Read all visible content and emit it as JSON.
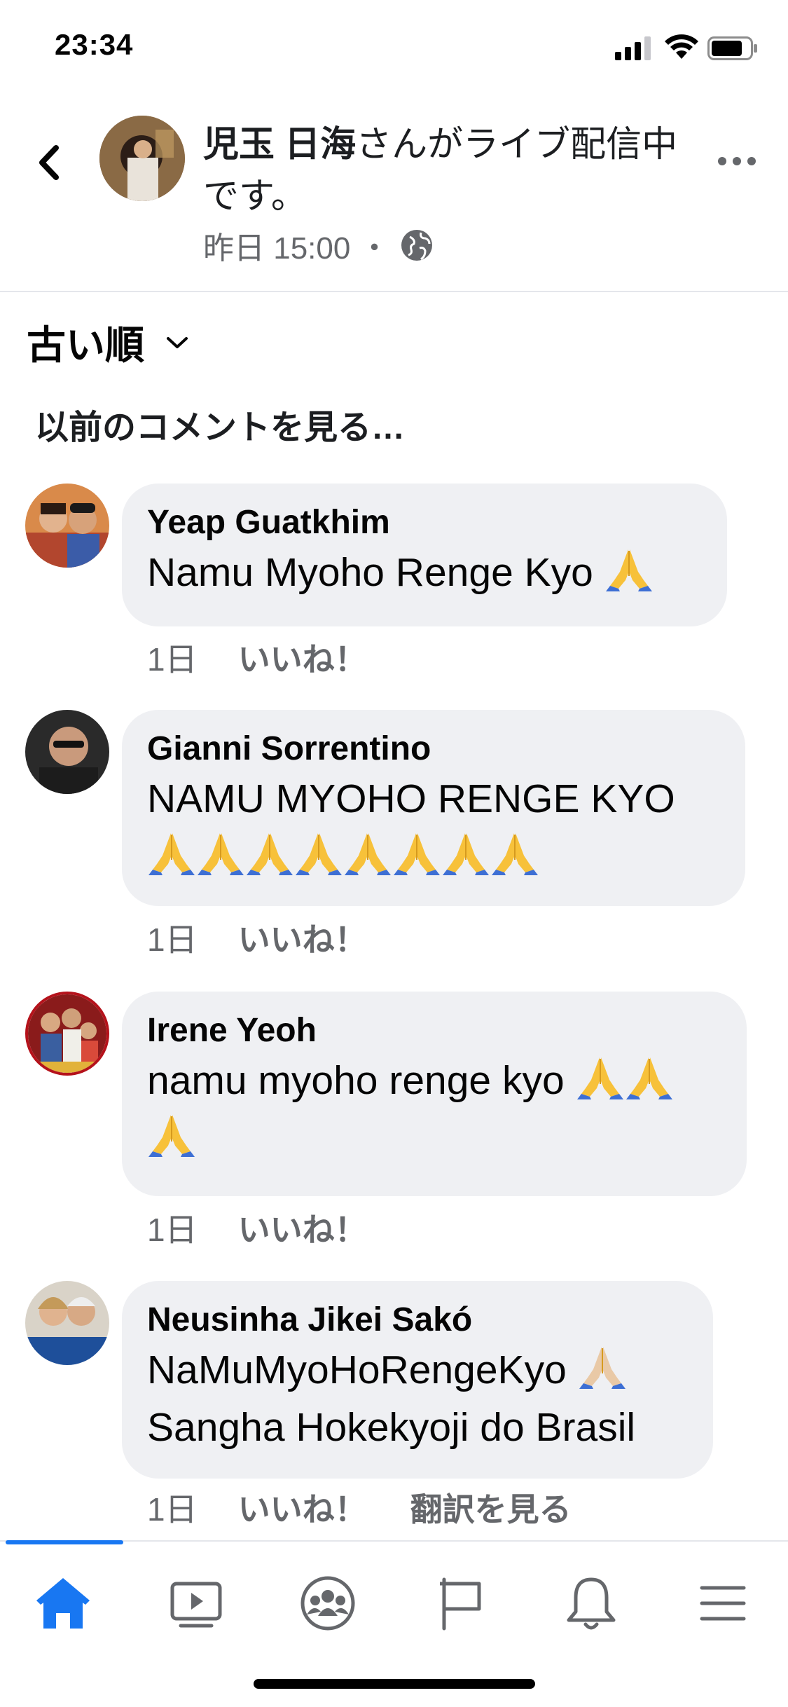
{
  "status_bar": {
    "time": "23:34"
  },
  "header": {
    "poster_name": "児玉 日海",
    "title_rest": "さんがライブ配信中です。",
    "meta_time": "昨日 15:00 ・",
    "icons": [
      "back-chevron-icon",
      "globe-icon",
      "more-dots-icon"
    ]
  },
  "sort": {
    "label": "古い順"
  },
  "previous_comments": "以前のコメントを見る…",
  "comments": [
    {
      "name": "Yeap Guatkhim",
      "text": "Namu Myoho Renge Kyo",
      "emoji_count": 1,
      "time": "1日",
      "like": "いいね！"
    },
    {
      "name": "Gianni Sorrentino",
      "text": "NAMU MYOHO RENGE KYO",
      "emoji_count": 8,
      "time": "1日",
      "like": "いいね！"
    },
    {
      "name": "Irene Yeoh",
      "text": "namu myoho renge kyo",
      "emoji_count": 3,
      "time": "1日",
      "like": "いいね！"
    },
    {
      "name": "Neusinha Jikei Sakó",
      "text": "NaMuMyoHoRengeKyo",
      "text2": "Sangha Hokekyoji do Brasil",
      "emoji_count": 1,
      "time": "1日",
      "like": "いいね！",
      "translate": "翻訳を見る"
    }
  ],
  "tabbar": {
    "items": [
      "home-icon",
      "video-icon",
      "groups-icon",
      "pages-flag-icon",
      "notifications-bell-icon",
      "menu-icon"
    ],
    "active": "home-icon",
    "accent": "#1877f2"
  }
}
